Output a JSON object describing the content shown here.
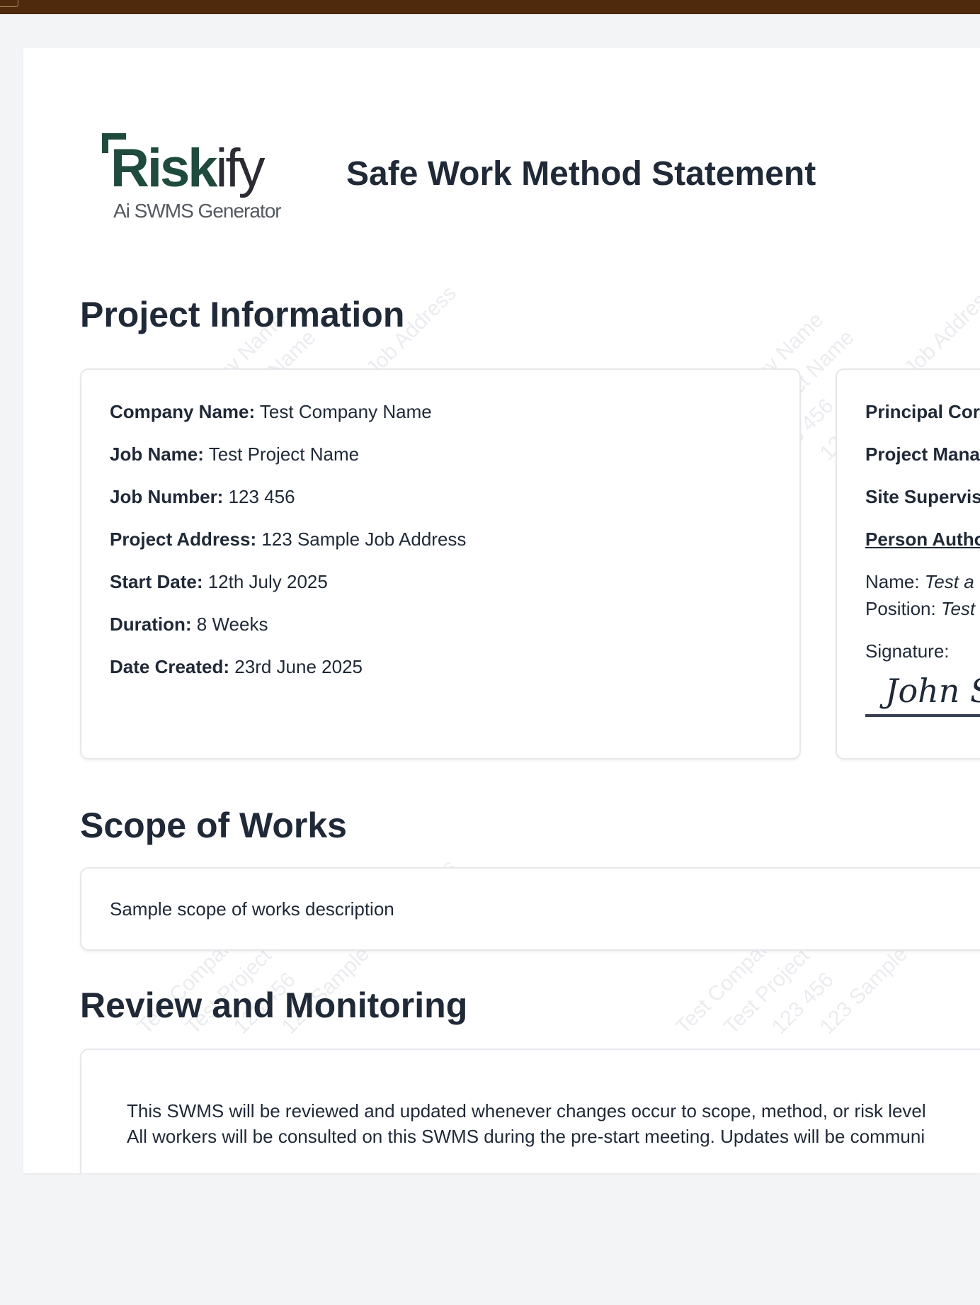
{
  "document": {
    "title": "Safe Work Method Statement",
    "logo": {
      "word_main": "Risk",
      "word_tail": "ify",
      "tagline": "Ai SWMS Generator"
    },
    "watermark_lines": [
      "Test Company Name",
      "Test Project Name",
      "123 456",
      "123 Sample Job Address"
    ]
  },
  "project_information": {
    "heading": "Project Information",
    "fields": [
      {
        "label": "Company Name:",
        "value": "Test Company Name"
      },
      {
        "label": "Job Name:",
        "value": "Test Project Name"
      },
      {
        "label": "Job Number:",
        "value": "123 456"
      },
      {
        "label": "Project Address:",
        "value": "123 Sample Job Address"
      },
      {
        "label": "Start Date:",
        "value": "12th July 2025"
      },
      {
        "label": "Duration:",
        "value": "8 Weeks"
      },
      {
        "label": "Date Created:",
        "value": "23rd June 2025"
      }
    ],
    "contacts": {
      "principal_label": "Principal Cor",
      "manager_label": "Project Mana",
      "supervisor_label": "Site Supervis",
      "authorised_heading": "Person Autho",
      "name_label": "Name:",
      "name_value": "Test a",
      "position_label": "Position:",
      "position_value": "Test",
      "signature_label": "Signature:",
      "signature_value": "John Sr"
    }
  },
  "scope_of_works": {
    "heading": "Scope of Works",
    "text": "Sample scope of works description"
  },
  "review_and_monitoring": {
    "heading": "Review and Monitoring",
    "line1": "This SWMS will be reviewed and updated whenever changes occur to scope, method, or risk level",
    "line2": "All workers will be consulted on this SWMS during the pre-start meeting. Updates will be communi"
  }
}
